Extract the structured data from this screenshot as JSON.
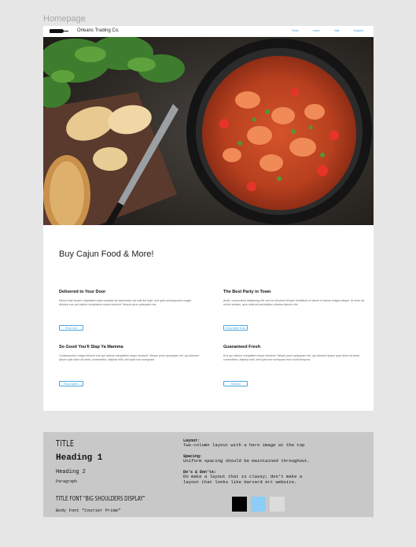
{
  "frame_label": "Homepage",
  "nav": {
    "brand": "Orleans Trading Co.",
    "links": [
      "Shop",
      "Learn",
      "Visit",
      "Support"
    ]
  },
  "headline": "Buy Cajun Food & More!",
  "cards": [
    {
      "title": "Delivered to Your Door",
      "text": "Nemo enim ipsam voluptatem quia voluptas sit aspernatur aut odit aut fugit, sed quia consequuntur magni dolores eos qui ratione voluptatem sequi nesciunt. Neque porro quisquam est.",
      "button": "Shop now"
    },
    {
      "title": "The Best Party in Town",
      "text": "Amet, consectetur adipiscing elit, sed do eiusmod tempor incididunt ut labore et dolore magna aliqua. Ut enim ad minim veniam, quis nostrud exercitation ullamco laboris nisi.",
      "button": "Shop Mardi Gras"
    },
    {
      "title": "So Good You'll Slap Ya Mamma",
      "text": "Consequuntur magni dolores eos qui ratione voluptatem sequi nesciunt. Neque porro quisquam est, qui dolorem ipsum quia dolor sit amet, consectetur, adipisci velit, sed quia non numquam.",
      "button": "Shop Spices"
    },
    {
      "title": "Guaranteed Fresh",
      "text": "Eos qui ratione voluptatem sequi nesciunt. Neque porro quisquam est, qui dolorem ipsum quia dolor sit amet, consectetur, adipisci velit, sed quia non numquam eius modi tempora.",
      "button": "Seafood"
    }
  ],
  "style_guide": {
    "title": "TITLE",
    "heading1": "Heading 1",
    "heading2": "Heading 2",
    "paragraph": "Paragraph",
    "title_font": "TITLE FONT “BIG SHOULDERS DISPLAY”",
    "body_font": "Body Font “Courier Prime”",
    "rules": [
      {
        "key": "Layout:",
        "value": "Two-column layout with a hero image at the top"
      },
      {
        "key": "Spacing:",
        "value": "Uniform spacing should be maintained throughout."
      },
      {
        "key": "Do's & Don'ts:",
        "value": "Do make a layout that is classy; don't make a\nlayout that looks like Harvard Art website."
      }
    ],
    "swatches": [
      "#000000",
      "#8ecdf7",
      "#dcdcdc"
    ]
  }
}
